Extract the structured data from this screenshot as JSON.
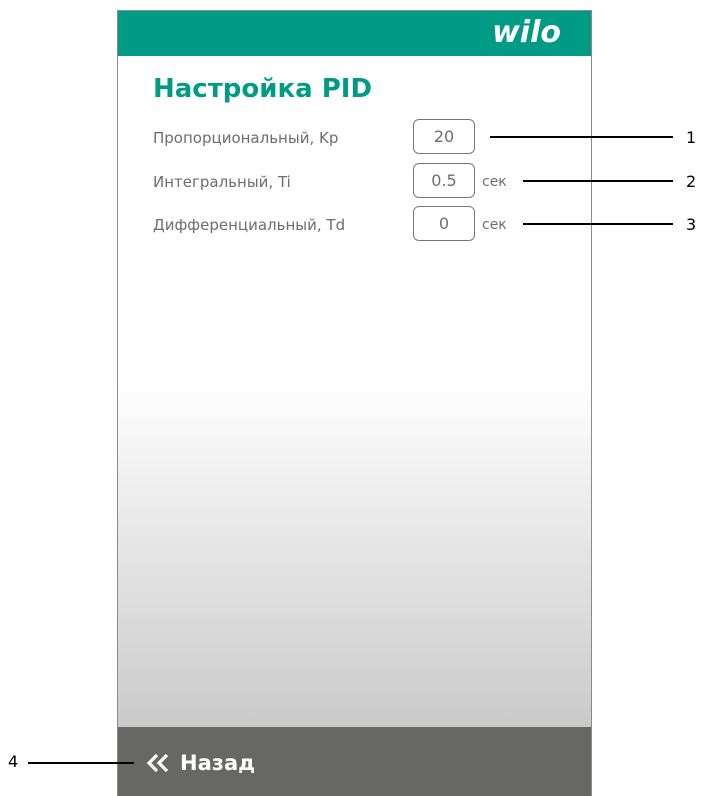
{
  "header": {
    "logo_text": "wilo"
  },
  "page": {
    "title": "Настройка PID"
  },
  "settings": [
    {
      "label": "Пропорциональный, Kp",
      "value": "20",
      "unit": ""
    },
    {
      "label": "Интегральный, Ti",
      "value": "0.5",
      "unit": "сек"
    },
    {
      "label": "Дифференциальный, Td",
      "value": "0",
      "unit": "сек"
    }
  ],
  "footer": {
    "back_label": "Назад",
    "back_icon": "double-chevron-left-icon"
  },
  "callouts": [
    "1",
    "2",
    "3",
    "4"
  ],
  "colors": {
    "brand": "#009b85",
    "footer_bg": "#676866",
    "text_muted": "#6d6d6d"
  }
}
